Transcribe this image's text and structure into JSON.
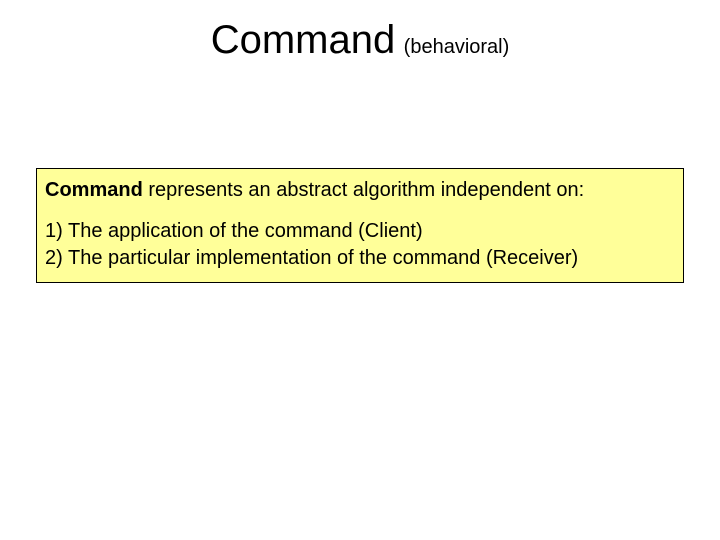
{
  "title": {
    "main": "Command",
    "sub": "(behavioral)"
  },
  "callout": {
    "lead_bold": "Command",
    "lead_rest": " represents an abstract algorithm independent on:",
    "items": [
      "1) The application of the command (Client)",
      "2) The particular implementation of the command (Receiver)"
    ]
  }
}
